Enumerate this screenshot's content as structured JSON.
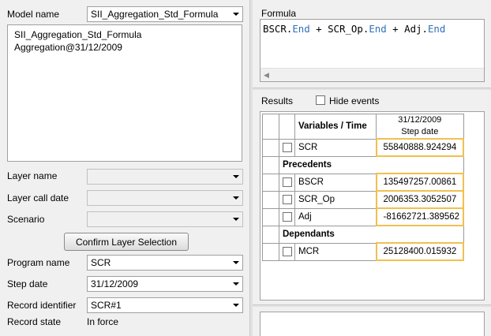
{
  "left": {
    "model_name_label": "Model name",
    "model_name_value": "SII_Aggregation_Std_Formula",
    "model_list": [
      "SII_Aggregation_Std_Formula",
      "Aggregation@31/12/2009"
    ],
    "layer_name_label": "Layer name",
    "layer_name_value": "",
    "layer_call_date_label": "Layer call date",
    "layer_call_date_value": "",
    "scenario_label": "Scenario",
    "scenario_value": "",
    "confirm_button": "Confirm Layer Selection",
    "program_name_label": "Program name",
    "program_name_value": "SCR",
    "step_date_label": "Step date",
    "step_date_value": "31/12/2009",
    "record_identifier_label": "Record identifier",
    "record_identifier_value": "SCR#1",
    "record_state_label": "Record state",
    "record_state_value": "In force"
  },
  "formula": {
    "label": "Formula",
    "parts": [
      "BSCR",
      ".",
      "End",
      " + ",
      "SCR_Op",
      ".",
      "End",
      " + ",
      "Adj",
      ".",
      "End"
    ]
  },
  "results": {
    "label": "Results",
    "hide_events_label": "Hide events",
    "col_header": "Variables / Time",
    "date_header_line1": "31/12/2009",
    "date_header_line2": "Step date",
    "main_row": {
      "name": "SCR",
      "value": "55840888.924294"
    },
    "precedents_label": "Precedents",
    "precedents": [
      {
        "name": "BSCR",
        "value": "135497257.00861"
      },
      {
        "name": "SCR_Op",
        "value": "2006353.3052507"
      },
      {
        "name": "Adj",
        "value": "-81662721.389562"
      }
    ],
    "dependants_label": "Dependants",
    "dependants": [
      {
        "name": "MCR",
        "value": "25128400.015932"
      }
    ]
  },
  "colors": {
    "keyword": "#2f6fb8",
    "highlight_border": "#f0c050"
  }
}
